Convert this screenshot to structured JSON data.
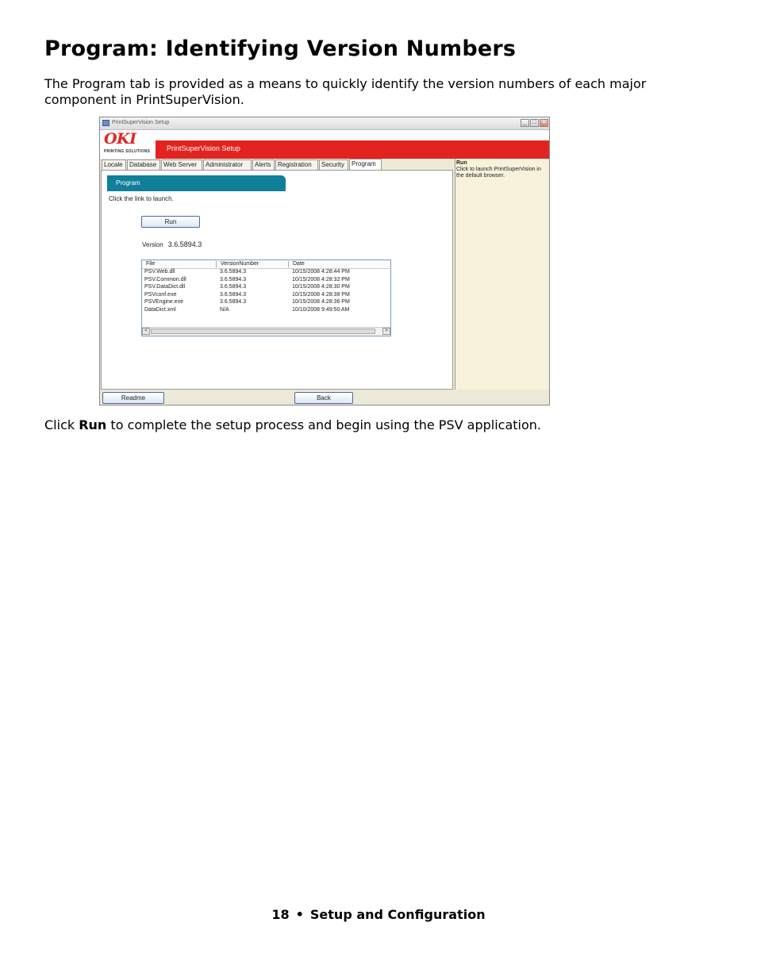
{
  "doc": {
    "title": "Program: Identifying Version Numbers",
    "intro": "The Program tab is provided as a means to quickly identify the version numbers of each major component in PrintSuperVision.",
    "outro_prefix": "Click ",
    "outro_bold": "Run",
    "outro_suffix": " to complete the setup process and begin using the PSV application.",
    "footer_page": "18",
    "footer_bullet": "•",
    "footer_section": "Setup and Configuration"
  },
  "window": {
    "title": "PrintSuperVision Setup",
    "min": "_",
    "max": "□",
    "close": "×",
    "logo": "OKI",
    "logo_sub": "PRINTING SOLUTIONS",
    "banner_title": "PrintSuperVision Setup",
    "tabs": [
      "Locale",
      "Database",
      "Web Server",
      "Administrator",
      "Alerts",
      "Registration",
      "Security",
      "Program"
    ],
    "section_header": "Program",
    "hint": "Click the link to launch.",
    "run_button": "Run",
    "version_label": "Version",
    "version_value": "3.6.5894.3",
    "list_headers": {
      "file": "File",
      "version": "VersionNumber",
      "date": "Date"
    },
    "files": [
      {
        "file": "PSV.Web.dll",
        "version": "3.6.5894.3",
        "date": "10/15/2008 4:28:44 PM"
      },
      {
        "file": "PSV.Common.dll",
        "version": "3.6.5894.3",
        "date": "10/15/2008 4:28:32 PM"
      },
      {
        "file": "PSV.DataDict.dll",
        "version": "3.6.5894.3",
        "date": "10/15/2008 4:28:30 PM"
      },
      {
        "file": "PSVconf.exe",
        "version": "3.6.5894.3",
        "date": "10/15/2008 4:28:38 PM"
      },
      {
        "file": "PSVEngine.exe",
        "version": "3.6.5894.3",
        "date": "10/15/2008 4:28:36 PM"
      },
      {
        "file": "DataDict.xml",
        "version": "N/A",
        "date": "10/10/2008 9:49:50 AM"
      }
    ],
    "scroll_left": "<",
    "scroll_right": ">",
    "help_title": "Run",
    "help_text": "Click to launch PrintSuperVision in the default browser.",
    "readme_button": "Readme",
    "back_button": "Back"
  }
}
